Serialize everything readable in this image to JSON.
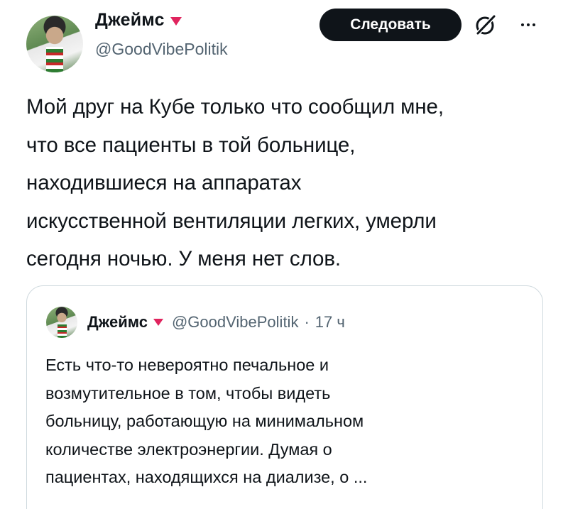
{
  "author": {
    "name": "Джеймс",
    "handle": "@GoodVibePolitik"
  },
  "actions": {
    "follow_label": "Следовать"
  },
  "icons": {
    "badge": "red-triangle-badge-icon",
    "grok": "grok-slash-icon",
    "more": "more-dots-icon"
  },
  "colors": {
    "badge": "#e0245e",
    "follow_bg": "#0f1419",
    "secondary_text": "#536471"
  },
  "tweet": {
    "lines": [
      "Мой друг на Кубе только что сообщил мне,",
      "что все пациенты в той больнице,",
      "находившиеся на аппаратах",
      "искусственной вентиляции легких, умерли",
      "сегодня ночью. У меня нет слов."
    ]
  },
  "quote": {
    "name": "Джеймс",
    "handle": "@GoodVibePolitik",
    "separator": "·",
    "time": "17 ч",
    "lines": [
      "Есть что-то невероятно печальное и",
      "возмутительное в том, чтобы видеть",
      "больницу, работающую на минимальном",
      "количестве электроэнергии. Думая о",
      "пациентах, находящихся на диализе, о ..."
    ]
  }
}
